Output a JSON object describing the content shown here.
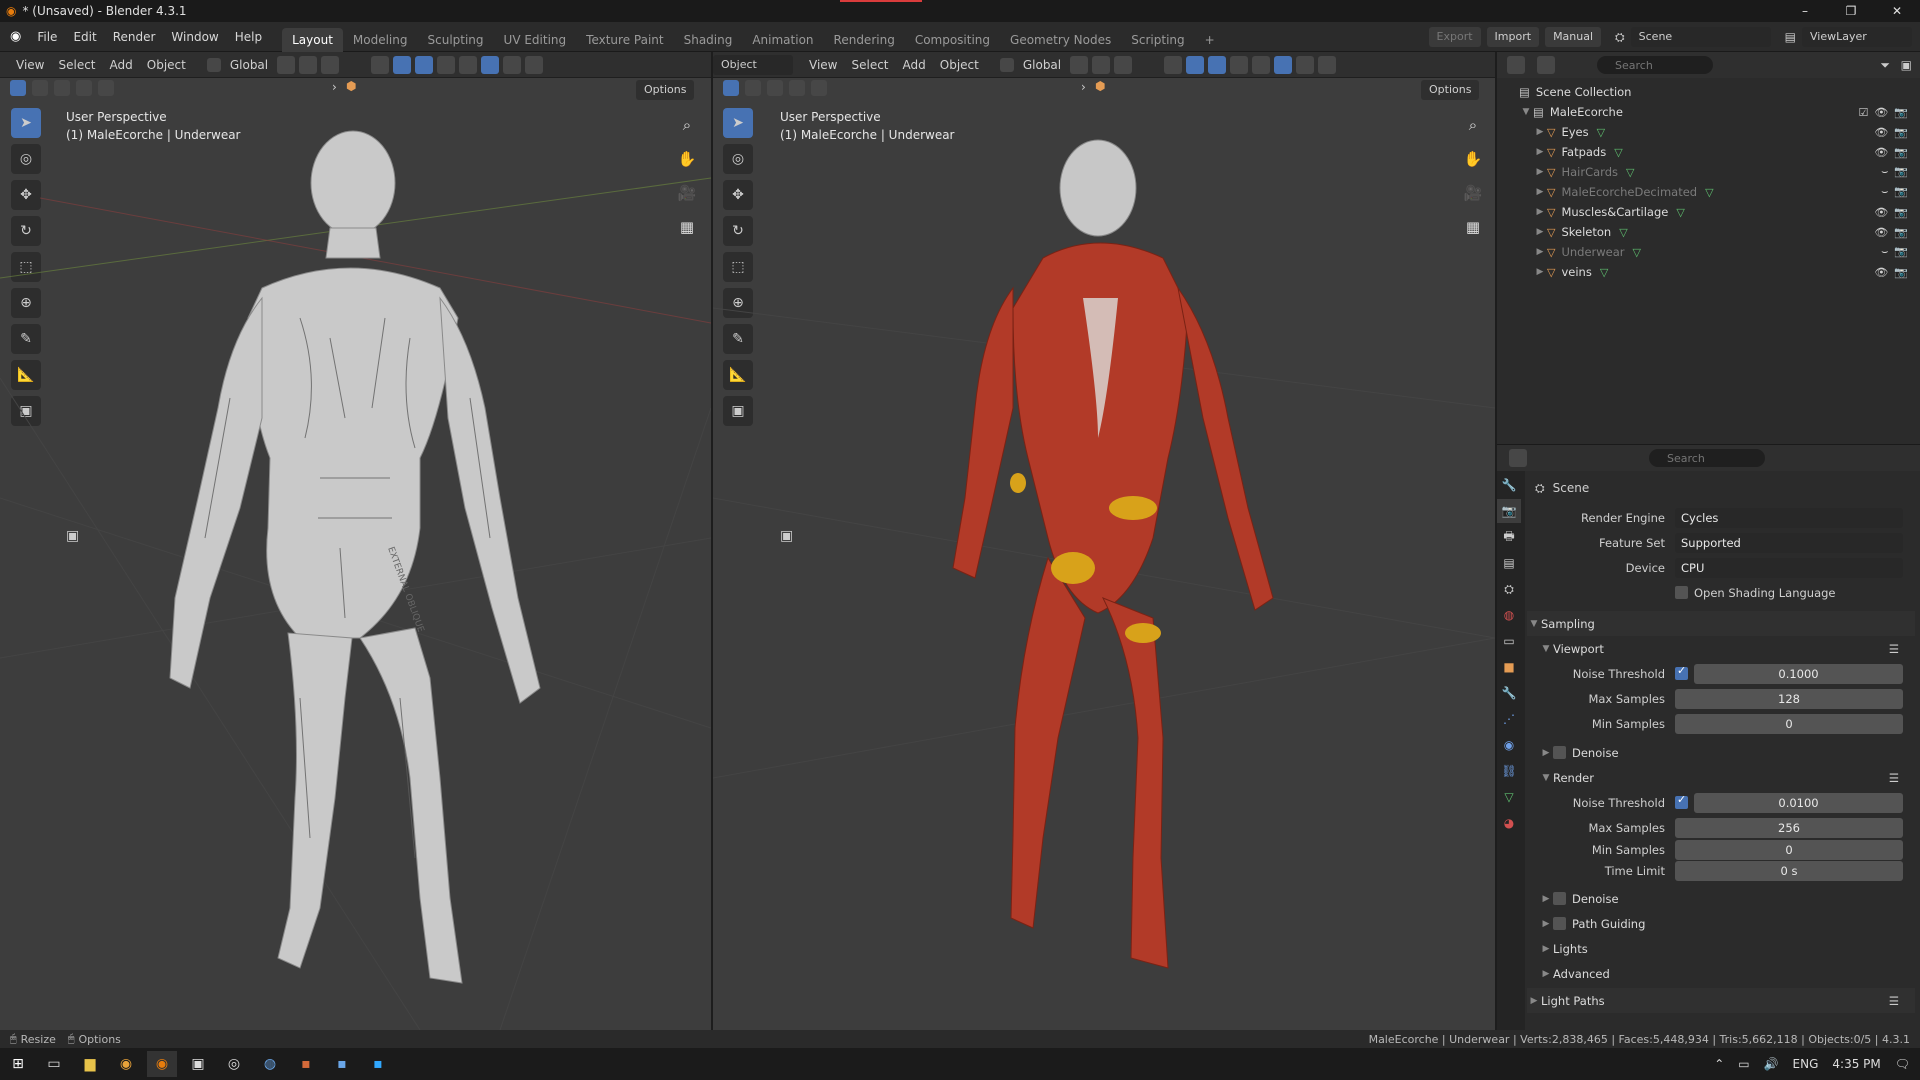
{
  "window": {
    "title": "* (Unsaved) - Blender 4.3.1",
    "controls": [
      "–",
      "❐",
      "✕"
    ]
  },
  "menus": [
    "File",
    "Edit",
    "Render",
    "Window",
    "Help"
  ],
  "workspaces": [
    "Layout",
    "Modeling",
    "Sculpting",
    "UV Editing",
    "Texture Paint",
    "Shading",
    "Animation",
    "Rendering",
    "Compositing",
    "Geometry Nodes",
    "Scripting"
  ],
  "add_workspace": "+",
  "topright": {
    "export": "Export",
    "import": "Import",
    "manual": "Manual",
    "scene": "Scene",
    "view_layer": "ViewLayer"
  },
  "left_viewport": {
    "header": {
      "view": "View",
      "select": "Select",
      "add": "Add",
      "object": "Object",
      "orientation": "Global",
      "options": "Options"
    },
    "info_line1": "User Perspective",
    "info_line2": "(1) MaleEcorche | Underwear"
  },
  "right_viewport": {
    "header": {
      "mode": "Object Mode",
      "view": "View",
      "select": "Select",
      "add": "Add",
      "object": "Object",
      "orientation": "Global",
      "options": "Options"
    },
    "info_line1": "User Perspective",
    "info_line2": "(1) MaleEcorche | Underwear"
  },
  "anatomy_labels": {
    "oblique": "EXTERNAL OBLIQUE"
  },
  "outliner": {
    "search_placeholder": "Search",
    "root": "Scene Collection",
    "collection": "MaleEcorche",
    "items": [
      {
        "name": "Eyes",
        "dim": false
      },
      {
        "name": "Fatpads",
        "dim": false
      },
      {
        "name": "HairCards",
        "dim": true
      },
      {
        "name": "MaleEcorcheDecimated",
        "dim": true
      },
      {
        "name": "Muscles&Cartilage",
        "dim": false
      },
      {
        "name": "Skeleton",
        "dim": false
      },
      {
        "name": "Underwear",
        "dim": true
      },
      {
        "name": "veins",
        "dim": false
      }
    ]
  },
  "properties": {
    "search_placeholder": "Search",
    "context": "Scene",
    "render_engine_label": "Render Engine",
    "render_engine": "Cycles",
    "feature_set_label": "Feature Set",
    "feature_set": "Supported",
    "device_label": "Device",
    "device": "CPU",
    "osl_label": "Open Shading Language",
    "sampling": "Sampling",
    "viewport": "Viewport",
    "vp_noise_label": "Noise Threshold",
    "vp_noise": "0.1000",
    "vp_max_label": "Max Samples",
    "vp_max": "128",
    "vp_min_label": "Min Samples",
    "vp_min": "0",
    "denoise": "Denoise",
    "render": "Render",
    "r_noise_label": "Noise Threshold",
    "r_noise": "0.0100",
    "r_max_label": "Max Samples",
    "r_max": "256",
    "r_min_label": "Min Samples",
    "r_min": "0",
    "time_limit_label": "Time Limit",
    "time_limit": "0 s",
    "denoise2": "Denoise",
    "path_guiding": "Path Guiding",
    "lights": "Lights",
    "advanced": "Advanced",
    "light_paths": "Light Paths"
  },
  "statusbar": {
    "resize": "Resize",
    "options": "Options",
    "stats": "MaleEcorche | Underwear | Verts:2,838,465 | Faces:5,448,934 | Tris:5,662,118 | Objects:0/5 | 4.3.1"
  },
  "taskbar": {
    "lang": "ENG",
    "time": "4:35 PM"
  },
  "colors": {
    "accent": "#4772b3",
    "object_orange": "#e59c54",
    "mesh_green": "#5fbf6f",
    "muscle_red": "#b23a28"
  }
}
